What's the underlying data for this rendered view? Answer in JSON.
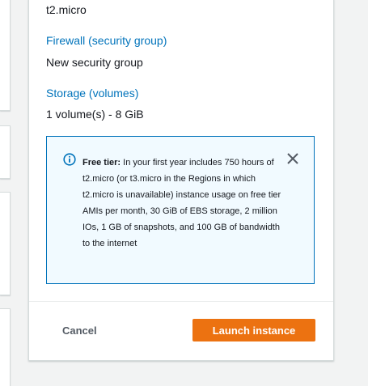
{
  "summary": {
    "instance_type_value": "t2.micro",
    "firewall_label": "Firewall (security group)",
    "firewall_value": "New security group",
    "storage_label": "Storage (volumes)",
    "storage_value": "1 volume(s) - 8 GiB"
  },
  "free_tier_alert": {
    "title": "Free tier:",
    "body": "In your first year includes 750 hours of t2.micro (or t3.micro in the Regions in which t2.micro is unavailable) instance usage on free tier AMIs per month, 30 GiB of EBS storage, 2 million IOs, 1 GB of snapshots, and 100 GB of bandwidth to the internet",
    "icon": "info-icon",
    "dismiss_icon": "close-icon"
  },
  "actions": {
    "cancel_label": "Cancel",
    "launch_label": "Launch instance"
  },
  "colors": {
    "link": "#0073bb",
    "primary_button": "#ec7211",
    "alert_background": "#f1faff",
    "alert_border": "#0073bb",
    "page_background": "#f2f3f3"
  }
}
